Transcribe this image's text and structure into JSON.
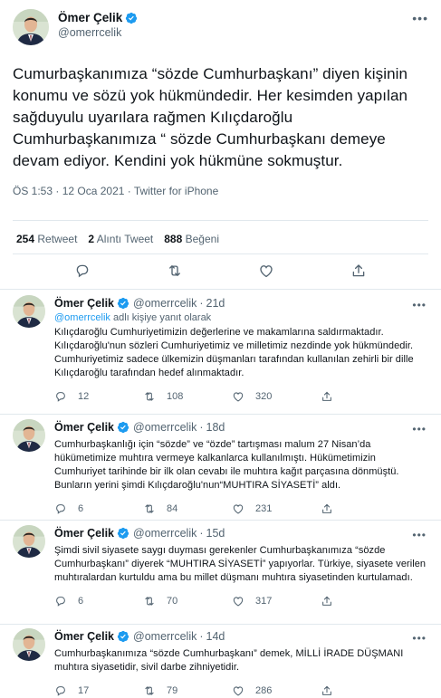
{
  "main_tweet": {
    "name": "Ömer Çelik",
    "handle": "@omerrcelik",
    "text": "Cumurbaşkanımıza “sözde Cumhurbaşkanı” diyen kişinin konumu ve sözü yok hükmündedir. Her kesimden yapılan sağduyulu  uyarılara rağmen Kılıçdaroğlu Cumhurbaşkanımıza “ sözde Cumhurbaşkanı demeye devam ediyor. Kendini yok hükmüne sokmuştur.",
    "time": "ÖS 1:53 · 12 Oca 2021",
    "source": "Twitter for iPhone",
    "retweets_count": "254",
    "retweets_label": "Retweet",
    "quotes_count": "2",
    "quotes_label": "Alıntı Tweet",
    "likes_count": "888",
    "likes_label": "Beğeni"
  },
  "replies": [
    {
      "name": "Ömer Çelik",
      "handle": "@omerrcelik",
      "time": "21d",
      "replying_handle": "@omerrcelik",
      "replying_suffix": "adlı kişiye yanıt olarak",
      "text": "Kılıçdaroğlu Cumhuriyetimizin değerlerine ve makamlarına saldırmaktadır. Kılıçdaroğlu'nun sözleri Cumhuriyetimiz ve milletimiz nezdinde yok hükmündedir. Cumhuriyetimiz sadece ülkemizin düşmanları tarafından kullanılan zehirli bir dille Kılıçdaroğlu tarafından hedef alınmaktadır.",
      "reply_count": "12",
      "retweet_count": "108",
      "like_count": "320"
    },
    {
      "name": "Ömer Çelik",
      "handle": "@omerrcelik",
      "time": "18d",
      "text": "Cumhurbaşkanlığı için “sözde” ve “özde” tartışması malum 27 Nisan’da hükümetimize muhtıra vermeye kalkanlarca kullanılmıştı. Hükümetimizin Cumhuriyet tarihinde bir ilk olan cevabı ile muhtıra kağıt parçasına dönmüştü. Bunların yerini şimdi Kılıçdaroğlu'nun“MUHTIRA SİYASETİ” aldı.",
      "reply_count": "6",
      "retweet_count": "84",
      "like_count": "231"
    },
    {
      "name": "Ömer Çelik",
      "handle": "@omerrcelik",
      "time": "15d",
      "text": "Şimdi sivil siyasete saygı duyması gerekenler Cumhurbaşkanımıza “sözde Cumhurbaşkanı” diyerek “MUHTIRA SİYASETİ” yapıyorlar. Türkiye, siyasete verilen muhtıralardan kurtuldu ama bu millet düşmanı muhtıra siyasetinden kurtulamadı.",
      "reply_count": "6",
      "retweet_count": "70",
      "like_count": "317"
    },
    {
      "name": "Ömer Çelik",
      "handle": "@omerrcelik",
      "time": "14d",
      "text": "Cumhurbaşkanımıza “sözde Cumhurbaşkanı” demek, MİLLİ İRADE DÜŞMANI muhtıra siyasetidir, sivil darbe zihniyetidir.",
      "reply_count": "17",
      "retweet_count": "79",
      "like_count": "286"
    }
  ],
  "colors": {
    "verified": "#1d9bf0",
    "secondary_text": "#536471",
    "divider": "#e1e8ed"
  },
  "icons": [
    "verified-badge-icon",
    "more-options-icon",
    "reply-icon",
    "retweet-icon",
    "like-icon",
    "share-icon"
  ]
}
